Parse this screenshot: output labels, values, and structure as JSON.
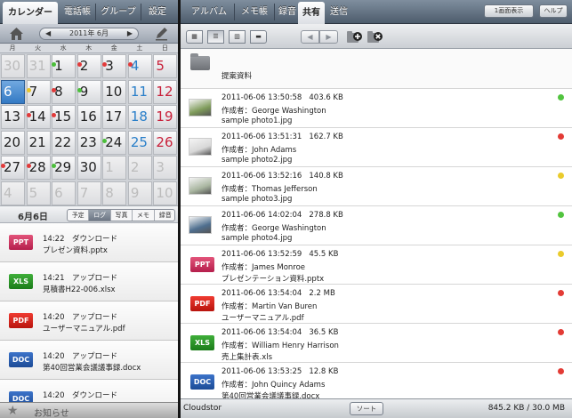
{
  "left_tabs": [
    {
      "label": "カレンダー",
      "active": true
    },
    {
      "label": "電話帳",
      "active": false
    },
    {
      "label": "グループ",
      "active": false
    },
    {
      "label": "設定",
      "active": false
    }
  ],
  "month_nav": {
    "title": "2011年 6月",
    "prev": "◀",
    "next": "▶"
  },
  "weekdays": [
    "月",
    "火",
    "水",
    "木",
    "金",
    "土",
    "日"
  ],
  "calendar_days": [
    {
      "d": "30",
      "dim": true
    },
    {
      "d": "31",
      "dim": true
    },
    {
      "d": "1",
      "dot": "g"
    },
    {
      "d": "2",
      "dot": "r"
    },
    {
      "d": "3",
      "dot": "r"
    },
    {
      "d": "4",
      "color": "#2a7fc9",
      "dot": "r"
    },
    {
      "d": "5",
      "color": "#c8203a"
    },
    {
      "d": "6",
      "today": true
    },
    {
      "d": "7",
      "dot": "y"
    },
    {
      "d": "8",
      "dot": "r"
    },
    {
      "d": "9",
      "dot": "g"
    },
    {
      "d": "10"
    },
    {
      "d": "11",
      "color": "#2a7fc9"
    },
    {
      "d": "12",
      "color": "#c8203a"
    },
    {
      "d": "13"
    },
    {
      "d": "14",
      "dot": "r"
    },
    {
      "d": "15",
      "dot": "r"
    },
    {
      "d": "16"
    },
    {
      "d": "17"
    },
    {
      "d": "18",
      "color": "#2a7fc9"
    },
    {
      "d": "19",
      "color": "#c8203a"
    },
    {
      "d": "20"
    },
    {
      "d": "21"
    },
    {
      "d": "22"
    },
    {
      "d": "23"
    },
    {
      "d": "24",
      "dot": "g"
    },
    {
      "d": "25",
      "color": "#2a7fc9"
    },
    {
      "d": "26",
      "color": "#c8203a"
    },
    {
      "d": "27",
      "dot": "r"
    },
    {
      "d": "28",
      "dot": "r"
    },
    {
      "d": "29",
      "dot": "g"
    },
    {
      "d": "30"
    },
    {
      "d": "1",
      "dim": true
    },
    {
      "d": "2",
      "dim": true
    },
    {
      "d": "3",
      "dim": true
    },
    {
      "d": "4",
      "dim": true
    },
    {
      "d": "5",
      "dim": true
    },
    {
      "d": "6",
      "dim": true
    },
    {
      "d": "7",
      "dim": true
    },
    {
      "d": "8",
      "dim": true
    },
    {
      "d": "9",
      "dim": true
    },
    {
      "d": "10",
      "dim": true
    }
  ],
  "selected_date": "6月6日",
  "detail_tabs": [
    {
      "label": "予定",
      "active": false
    },
    {
      "label": "ログ",
      "active": true
    },
    {
      "label": "写真",
      "active": false
    },
    {
      "label": "メモ",
      "active": false
    },
    {
      "label": "録音",
      "active": false
    }
  ],
  "log_entries": [
    {
      "badge": "PPT",
      "kind": "ppt",
      "line1": "14:22　ダウンロード",
      "line2": "プレゼン資料.pptx"
    },
    {
      "badge": "XLS",
      "kind": "xls",
      "line1": "14:21　アップロード",
      "line2": "見積書H22-006.xlsx"
    },
    {
      "badge": "PDF",
      "kind": "pdf",
      "line1": "14:20　アップロード",
      "line2": "ユーザーマニュアル.pdf"
    },
    {
      "badge": "DOC",
      "kind": "doc",
      "line1": "14:20　アップロード",
      "line2": "第40回営業会議議事録.docx"
    },
    {
      "badge": "DOC",
      "kind": "doc",
      "line1": "14:20　ダウンロード",
      "line2": ""
    }
  ],
  "notice_label": "お知らせ",
  "right_tabs": [
    {
      "label": "アルバム",
      "active": false
    },
    {
      "label": "メモ帳",
      "active": false
    },
    {
      "label": "録音",
      "active": false
    },
    {
      "label": "共有",
      "active": true
    },
    {
      "label": "送信",
      "active": false
    }
  ],
  "single_view_label": "1画面表示",
  "help_label": "ヘルプ",
  "view_buttons": [
    {
      "icon": "grid-view-icon",
      "glyph": "▦",
      "active": false
    },
    {
      "icon": "list-view-icon",
      "glyph": "☰",
      "active": true
    },
    {
      "icon": "column-view-icon",
      "glyph": "▥",
      "active": false
    },
    {
      "icon": "cover-view-icon",
      "glyph": "▬",
      "active": false
    }
  ],
  "folder_name": "提案資料",
  "files": [
    {
      "thumb": "photo",
      "tone": "#7e9b5a",
      "date": "2011-06-06 13:50:58",
      "size": "403.6 KB",
      "author": "作成者：George Washington",
      "name": "sample photo1.jpg",
      "status": "g"
    },
    {
      "thumb": "photo",
      "tone": "#d8d8d8",
      "date": "2011-06-06 13:51:31",
      "size": "162.7 KB",
      "author": "作成者：John Adams",
      "name": "sample photo2.jpg",
      "status": "r"
    },
    {
      "thumb": "photo",
      "tone": "#a9b6a0",
      "date": "2011-06-06 13:52:16",
      "size": "140.8 KB",
      "author": "作成者：Thomas Jefferson",
      "name": "sample photo3.jpg",
      "status": "y"
    },
    {
      "thumb": "photo",
      "tone": "#4f6f8f",
      "date": "2011-06-06 14:02:04",
      "size": "278.8 KB",
      "author": "作成者：George Washington",
      "name": "sample photo4.jpg",
      "status": "g"
    },
    {
      "thumb": "badge",
      "badge": "PPT",
      "kind": "ppt",
      "date": "2011-06-06 13:52:59",
      "size": "45.5 KB",
      "author": "作成者：James Monroe",
      "name": "プレゼンテーション資料.pptx",
      "status": "y"
    },
    {
      "thumb": "badge",
      "badge": "PDF",
      "kind": "pdf",
      "date": "2011-06-06 13:54:04",
      "size": "2.2 MB",
      "author": "作成者：Martin Van Buren",
      "name": "ユーザーマニュアル.pdf",
      "status": "r"
    },
    {
      "thumb": "badge",
      "badge": "XLS",
      "kind": "xls",
      "date": "2011-06-06 13:54:04",
      "size": "36.5 KB",
      "author": "作成者：William Henry Harrison",
      "name": "売上集計表.xls",
      "status": "r"
    },
    {
      "thumb": "badge",
      "badge": "DOC",
      "kind": "doc",
      "date": "2011-06-06 13:53:25",
      "size": "12.8 KB",
      "author": "作成者：John Quincy Adams",
      "name": "第40回営業会議議事録.docx",
      "status": "r"
    }
  ],
  "status_bar": {
    "app_name": "Cloudstor",
    "sort_label": "ソート",
    "storage": "845.2 KB / 30.0 MB"
  }
}
